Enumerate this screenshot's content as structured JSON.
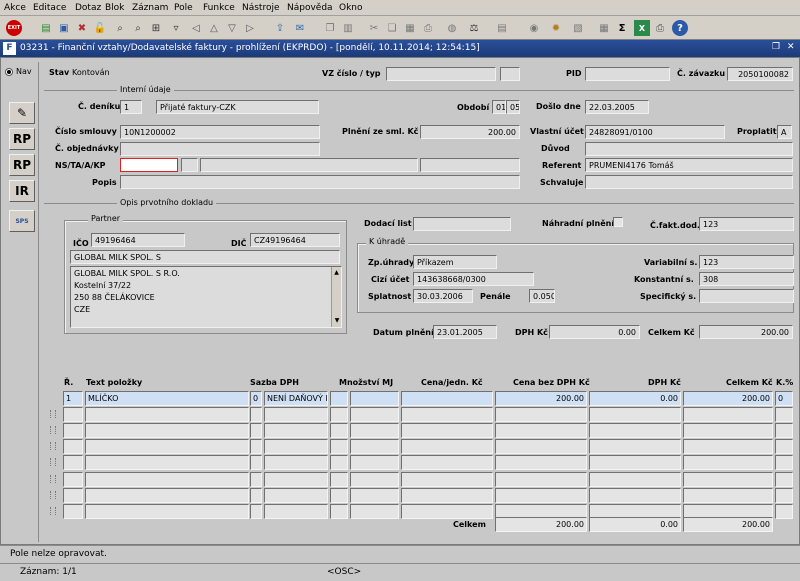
{
  "menu": [
    "Akce",
    "Editace",
    "Dotaz",
    "Blok",
    "Záznam",
    "Pole",
    "Funkce",
    "Nástroje",
    "Nápověda",
    "Okno"
  ],
  "toolbar_icons": [
    "exit-icon",
    "insert-record-icon",
    "save-icon",
    "delete-icon",
    "unlock-icon",
    "search-icon",
    "search2-icon",
    "find-icon",
    "filter-icon",
    "arrow-left-icon",
    "arrow-up-icon",
    "arrow-down-icon",
    "arrow-right-icon",
    "send-icon",
    "mail-icon",
    "copy-icon",
    "paste-icon",
    "cut-icon",
    "duplicate-icon",
    "calculator-icon",
    "print-icon",
    "globe-icon",
    "scale-icon",
    "book-icon",
    "sigma-icon",
    "excel-icon",
    "print2-icon",
    "help-icon"
  ],
  "window": {
    "title": "03231 - Finanční vztahy/Dodavatelské faktury - prohlížení (EKPRDO) - [pondělí, 10.11.2014; 12:54:15]",
    "title_icon": "F"
  },
  "nav": {
    "label": "Nav"
  },
  "side_buttons": [
    {
      "label": "",
      "name": "doc-edit-icon"
    },
    {
      "label": "RP",
      "name": "rp-cz-icon"
    },
    {
      "label": "RP",
      "name": "rp-eu-icon"
    },
    {
      "label": "IR",
      "name": "ir-cz-icon"
    },
    {
      "label": "SPS",
      "name": "sps-icon"
    }
  ],
  "header": {
    "stav_label": "Stav",
    "stav_value": "Kontován",
    "vz_label": "VZ číslo / typ",
    "vz_value": "",
    "vz_type": "",
    "pid_label": "PID",
    "pid_value": "",
    "zavazek_label": "Č. závazku",
    "zavazek_value": "2050100082"
  },
  "interni": {
    "group": "Interní údaje",
    "denik_label": "Č. deníku",
    "denik_value": "1",
    "denik_text": "Přijaté faktury-CZK",
    "obdobi_label": "Období",
    "obdobi_value1": "01",
    "obdobi_value2": "05",
    "doslo_label": "Došlo dne",
    "doslo_value": "22.03.2005",
    "smlouva_label": "Číslo smlouvy",
    "smlouva_value": "10N1200002",
    "plneni_label": "Plnění ze sml. Kč",
    "plneni_value": "200.00",
    "ucet_label": "Vlastní účet",
    "ucet_value": "24828091/0100",
    "proplatit_label": "Proplatit",
    "proplatit_value": "A",
    "objednavky_label": "Č. objednávky",
    "objednavky_value": "",
    "duvod_label": "Důvod",
    "duvod_value": "",
    "ns_label": "NS/TA/A/KP",
    "ns_values": [
      "",
      "",
      "",
      ""
    ],
    "referent_label": "Referent",
    "referent_value": "PRUMENI4176 Tomáš",
    "popis_label": "Popis",
    "popis_value": "",
    "schvaluje_label": "Schvaluje",
    "schvaluje_value": ""
  },
  "opis": {
    "group": "Opis prvotního dokladu",
    "partner_group": "Partner",
    "ico_label": "IČO",
    "ico_value": "49196464",
    "dic_label": "DIČ",
    "dic_value": "CZ49196464",
    "partner_name": "GLOBAL MILK SPOL. S",
    "address": [
      "GLOBAL MILK SPOL. S R.O.",
      "Kostelní  37/22",
      "250 88 ČELÁKOVICE",
      "CZE"
    ],
    "dodaci_label": "Dodací list",
    "dodaci_value": "",
    "nahradni_label": "Náhradní plnění",
    "cfakt_label": "Č.fakt.dod.",
    "cfakt_value": "123",
    "uhrade_group": "K úhradě",
    "zpuhrady_label": "Zp.úhrady",
    "zpuhrady_value": "Příkazem",
    "variabilni_label": "Variabilní s.",
    "variabilni_value": "123",
    "cizi_label": "Cizí účet",
    "cizi_value": "143638668/0300",
    "konstantni_label": "Konstantní s.",
    "konstantni_value": "308",
    "splatnost_label": "Splatnost",
    "splatnost_value": "30.03.2006",
    "penale_label": "Penále",
    "penale_value": "0.050",
    "specificky_label": "Specifický s.",
    "specificky_value": "",
    "datum_label": "Datum plnění",
    "datum_value": "23.01.2005",
    "dph_label": "DPH Kč",
    "dph_value": "0.00",
    "celkem_label": "Celkem Kč",
    "celkem_value": "200.00"
  },
  "table": {
    "headers": [
      "Ř.",
      "Text položky",
      "Sazba DPH",
      "Množství MJ",
      "Cena/jedn. Kč",
      "Cena bez DPH Kč",
      "DPH Kč",
      "Celkem Kč",
      "K.%"
    ],
    "rows": [
      [
        "1",
        "MLÍČKO",
        "0",
        "NENÍ DAŇOVÝ I",
        "",
        "",
        "",
        "200.00",
        "0.00",
        "200.00",
        "0"
      ]
    ],
    "empty_rows": 7,
    "total_label": "Celkem",
    "total_values": [
      "200.00",
      "0.00",
      "200.00"
    ]
  },
  "status": {
    "message": "Pole nelze opravovat.",
    "record": "Záznam: 1/1",
    "osc": "<OSC>"
  }
}
